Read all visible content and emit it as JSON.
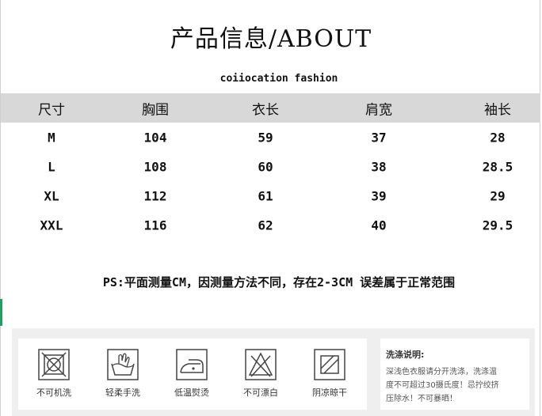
{
  "title": "产品信息/ABOUT",
  "brand": "coiiocation fashion",
  "table": {
    "headers": [
      "尺寸",
      "胸围",
      "衣长",
      "肩宽",
      "袖长"
    ],
    "rows": [
      [
        "M",
        "104",
        "59",
        "37",
        "28"
      ],
      [
        "L",
        "108",
        "60",
        "38",
        "28.5"
      ],
      [
        "XL",
        "112",
        "61",
        "39",
        "29"
      ],
      [
        "XXL",
        "116",
        "62",
        "40",
        "29.5"
      ]
    ]
  },
  "note": "PS:平面测量CM，因测量方法不同，存在2-3CM 误差属于正常范围",
  "care": {
    "items": [
      {
        "icon": "no-machine-wash-icon",
        "label": "不可机洗"
      },
      {
        "icon": "gentle-hand-wash-icon",
        "label": "轻柔手洗"
      },
      {
        "icon": "low-temp-iron-icon",
        "label": "低温熨烫"
      },
      {
        "icon": "no-bleach-icon",
        "label": "不可漂白"
      },
      {
        "icon": "shade-dry-icon",
        "label": "阴凉晾干"
      }
    ],
    "wash_title": "洗涤说明:",
    "wash_lines": [
      "深浅色衣服请分开洗涤，洗涤温",
      "度不可超过30摄氏度！忌拧绞挤",
      "压除水！不可暴晒！"
    ]
  },
  "colors": {
    "header_bg": "#d8d8d8",
    "care_band": "#efefef",
    "accent_green": "#1aa260"
  }
}
